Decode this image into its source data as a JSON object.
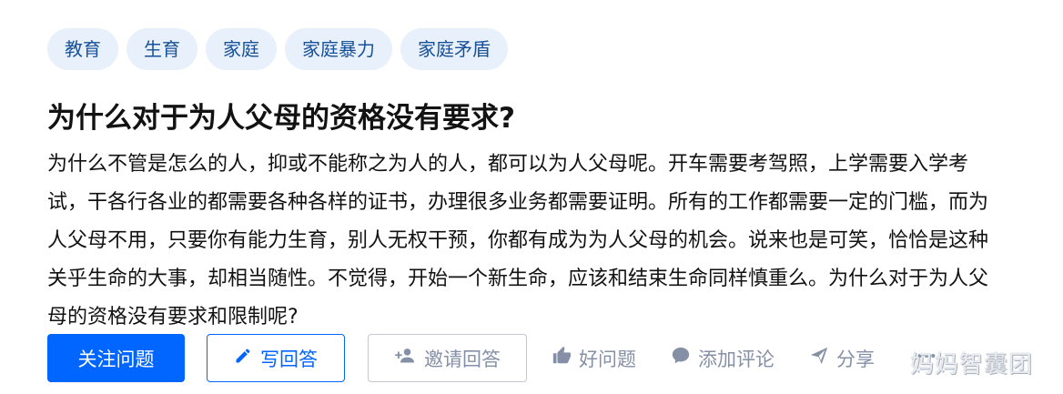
{
  "topics": [
    "教育",
    "生育",
    "家庭",
    "家庭暴力",
    "家庭矛盾"
  ],
  "question": {
    "title": "为什么对于为人父母的资格没有要求?",
    "description": "为什么不管是怎么的人，抑或不能称之为人的人，都可以为人父母呢。开车需要考驾照，上学需要入学考试，干各行各业的都需要各种各样的证书，办理很多业务都需要证明。所有的工作都需要一定的门槛，而为人父母不用，只要你有能力生育，别人无权干预，你都有成为为人父母的机会。说来也是可笑，恰恰是这种关乎生命的大事，却相当随性。不觉得，开始一个新生命，应该和结束生命同样慎重么。为什么对于为人父母的资格没有要求和限制呢?"
  },
  "actions": {
    "follow": "关注问题",
    "write_answer": "写回答",
    "invite": "邀请回答",
    "good_question": "好问题",
    "comment": "添加评论",
    "share": "分享"
  },
  "watermark": "妈妈智囊团",
  "colors": {
    "primary": "#0066ff",
    "tag_bg": "#e8f0fc",
    "tag_text": "#175199",
    "muted": "#8590a6"
  }
}
